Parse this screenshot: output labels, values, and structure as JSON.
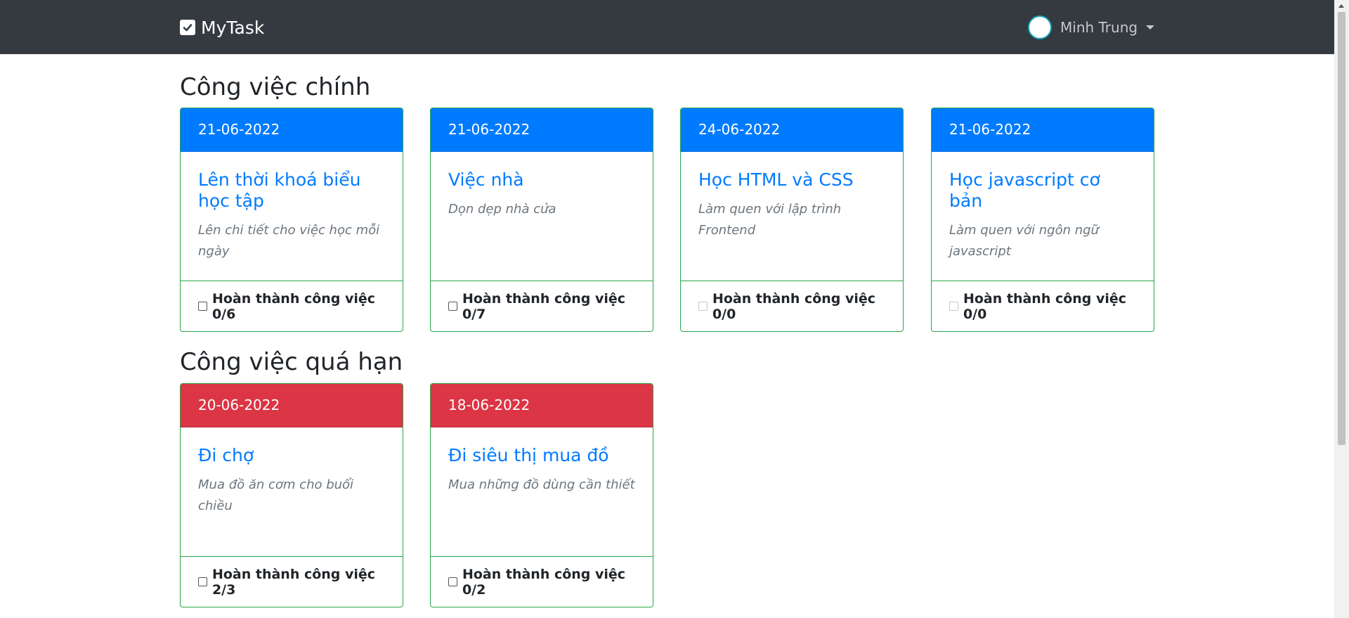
{
  "app": {
    "brand": "MyTask",
    "brand_icon": "checkbox-icon",
    "user_name": "Minh Trung"
  },
  "colors": {
    "navbar": "#343a40",
    "primary": "#007bff",
    "danger": "#dc3545",
    "success_border": "#28a745"
  },
  "sections": {
    "main": {
      "title": "Công việc chính",
      "cards": [
        {
          "date": "21-06-2022",
          "title": "Lên thời khoá biểu học tập",
          "desc": "Lên chi tiết cho việc học mỗi ngày",
          "progress": "Hoàn thành công việc 0/6"
        },
        {
          "date": "21-06-2022",
          "title": "Việc nhà",
          "desc": "Dọn dẹp nhà cửa",
          "progress": "Hoàn thành công việc 0/7"
        },
        {
          "date": "24-06-2022",
          "title": "Học HTML và CSS",
          "desc": "Làm quen với lập trình Frontend",
          "progress": "Hoàn thành công việc 0/0"
        },
        {
          "date": "21-06-2022",
          "title": "Học javascript cơ bản",
          "desc": "Làm quen với ngôn ngữ javascript",
          "progress": "Hoàn thành công việc 0/0"
        }
      ]
    },
    "overdue": {
      "title": "Công việc quá hạn",
      "cards": [
        {
          "date": "20-06-2022",
          "title": "Đi chợ",
          "desc": "Mua đồ ăn cơm cho buổi chiều",
          "progress": "Hoàn thành công việc 2/3"
        },
        {
          "date": "18-06-2022",
          "title": "Đi siêu thị mua đồ",
          "desc": "Mua những đồ dùng cần thiết",
          "progress": "Hoàn thành công việc 0/2"
        }
      ]
    }
  }
}
